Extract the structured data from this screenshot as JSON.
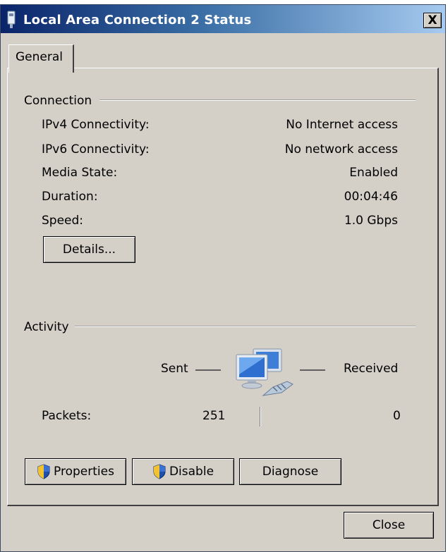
{
  "window": {
    "title": "Local Area Connection 2 Status",
    "close_glyph": "X"
  },
  "tabs": [
    {
      "label": "General",
      "selected": true
    }
  ],
  "connection": {
    "heading": "Connection",
    "rows": [
      {
        "label": "IPv4 Connectivity:",
        "value": "No Internet access"
      },
      {
        "label": "IPv6 Connectivity:",
        "value": "No network access"
      },
      {
        "label": "Media State:",
        "value": "Enabled"
      },
      {
        "label": "Duration:",
        "value": "00:04:46"
      },
      {
        "label": "Speed:",
        "value": "1.0 Gbps"
      }
    ],
    "details_button": "Details..."
  },
  "activity": {
    "heading": "Activity",
    "sent_label": "Sent",
    "received_label": "Received",
    "icon": "network-computers-icon",
    "packets_label": "Packets:",
    "packets_sent": "251",
    "packets_received": "0"
  },
  "buttons": {
    "properties": "Properties",
    "disable": "Disable",
    "diagnose": "Diagnose",
    "close": "Close"
  },
  "icons": {
    "title": "network-adapter-icon",
    "shield": "uac-shield-icon"
  },
  "colors": {
    "titlebar_start": "#0a246a",
    "titlebar_end": "#a6caf0",
    "face": "#d4d0c8"
  }
}
